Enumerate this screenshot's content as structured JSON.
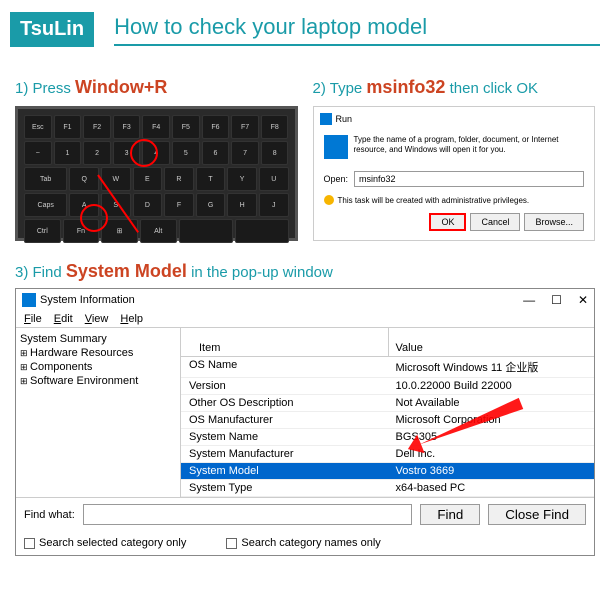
{
  "brand": "TsuLin",
  "title": "How to check your laptop model",
  "step1": {
    "label_prefix": "1) Press ",
    "highlight": "Window+R"
  },
  "step2": {
    "label_prefix": "2) Type ",
    "highlight": "msinfo32",
    "label_suffix": " then click OK"
  },
  "run": {
    "title": "Run",
    "desc": "Type the name of a program, folder, document, or Internet resource, and Windows will open it for you.",
    "open_label": "Open:",
    "input_value": "msinfo32",
    "admin_text": "This task will be created with administrative privileges.",
    "ok": "OK",
    "cancel": "Cancel",
    "browse": "Browse..."
  },
  "step3": {
    "label_prefix": "3) Find ",
    "highlight": "System Model",
    "label_suffix": " in the pop-up window"
  },
  "sysinfo": {
    "title": "System Information",
    "menu": [
      "File",
      "Edit",
      "View",
      "Help"
    ],
    "tree": {
      "root": "System Summary",
      "children": [
        "Hardware Resources",
        "Components",
        "Software Environment"
      ]
    },
    "columns": [
      "Item",
      "Value"
    ],
    "rows": [
      {
        "item": "OS Name",
        "value": "Microsoft Windows 11 企业版"
      },
      {
        "item": "Version",
        "value": "10.0.22000 Build 22000"
      },
      {
        "item": "Other OS Description",
        "value": "Not Available"
      },
      {
        "item": "OS Manufacturer",
        "value": "Microsoft Corporation"
      },
      {
        "item": "System Name",
        "value": "BGS305"
      },
      {
        "item": "System Manufacturer",
        "value": "Dell Inc."
      },
      {
        "item": "System Model",
        "value": "Vostro 3669",
        "selected": true
      },
      {
        "item": "System Type",
        "value": "x64-based PC"
      }
    ],
    "find": {
      "label": "Find what:",
      "btn_find": "Find",
      "btn_close": "Close Find",
      "chk1": "Search selected category only",
      "chk2": "Search category names only"
    },
    "winbtns": {
      "min": "—",
      "max": "☐",
      "close": "✕"
    }
  }
}
